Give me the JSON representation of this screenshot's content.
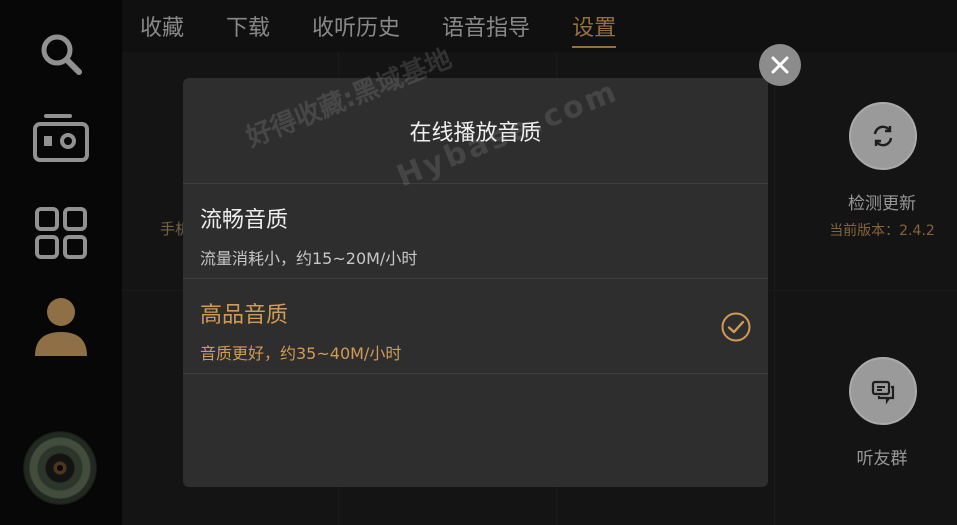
{
  "tabs": [
    {
      "label": "收藏"
    },
    {
      "label": "下载"
    },
    {
      "label": "收听历史"
    },
    {
      "label": "语音指导"
    },
    {
      "label": "设置",
      "active": true
    }
  ],
  "sidebar": {
    "icons": [
      "search-icon",
      "radio-icon",
      "grid-icon",
      "user-icon"
    ],
    "accent": "#d19a55"
  },
  "settings": {
    "partial_left_text": "手机",
    "check_update_label": "检测更新",
    "version_label": "当前版本：2.4.2",
    "listen_group_label": "听友群"
  },
  "modal": {
    "title": "在线播放音质",
    "options": [
      {
        "name": "流畅音质",
        "desc": "流量消耗小，约15~20M/小时",
        "selected": false
      },
      {
        "name": "高品音质",
        "desc": "音质更好，约35~40M/小时",
        "selected": true
      }
    ]
  },
  "watermark": {
    "line1": "好得收藏:黑域基地",
    "line2": "Hybase.com"
  }
}
